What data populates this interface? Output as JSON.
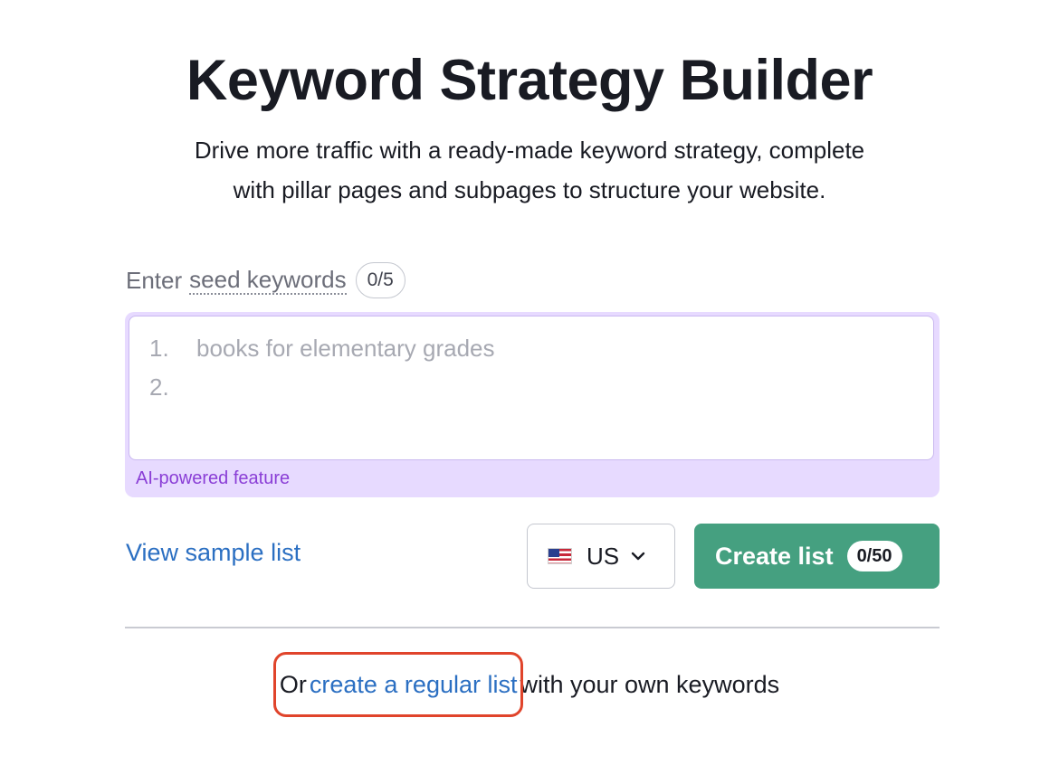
{
  "header": {
    "title": "Keyword Strategy Builder",
    "subtitle_line1": "Drive more traffic with a ready-made keyword strategy, complete",
    "subtitle_line2": "with pillar pages and subpages to structure your website."
  },
  "seed": {
    "label_prefix": "Enter",
    "label_link": "seed keywords",
    "count": "0/5"
  },
  "keyword_input": {
    "line1_number": "1.",
    "line1_placeholder": "books for elementary grades",
    "line2_number": "2.",
    "ai_label": "AI-powered feature"
  },
  "actions": {
    "view_sample": "View sample list",
    "country_code": "US",
    "create_label": "Create list",
    "create_count": "0/50"
  },
  "footer": {
    "prefix": "Or",
    "link": "create a regular list",
    "suffix": "with your own keywords"
  },
  "colors": {
    "primary_button": "#45a080",
    "link": "#2b6fc2",
    "ai_background": "#e7daff",
    "ai_text": "#8a3ed6",
    "highlight": "#e0442b"
  },
  "icons": {
    "flag": "us-flag-icon",
    "dropdown": "chevron-down-icon"
  }
}
